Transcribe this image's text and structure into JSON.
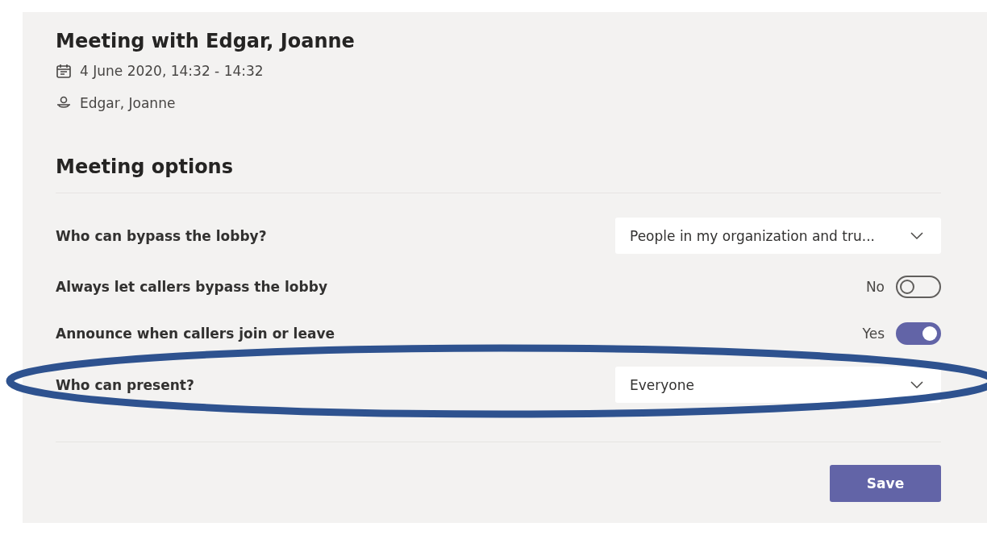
{
  "meeting": {
    "title": "Meeting with Edgar, Joanne",
    "date": "4 June 2020, 14:32 - 14:32",
    "participants": "Edgar, Joanne"
  },
  "options_heading": "Meeting options",
  "options": [
    {
      "kind": "dropdown",
      "label": "Who can bypass the lobby?",
      "value": "People in my organization and tru...",
      "highlighted": false
    },
    {
      "kind": "toggle",
      "label": "Always let callers bypass the lobby",
      "state_text": "No",
      "on": false,
      "highlighted": false
    },
    {
      "kind": "toggle",
      "label": "Announce when callers join or leave",
      "state_text": "Yes",
      "on": true,
      "highlighted": false
    },
    {
      "kind": "dropdown",
      "label": "Who can present?",
      "value": "Everyone",
      "highlighted": true
    }
  ],
  "save_button": "Save"
}
